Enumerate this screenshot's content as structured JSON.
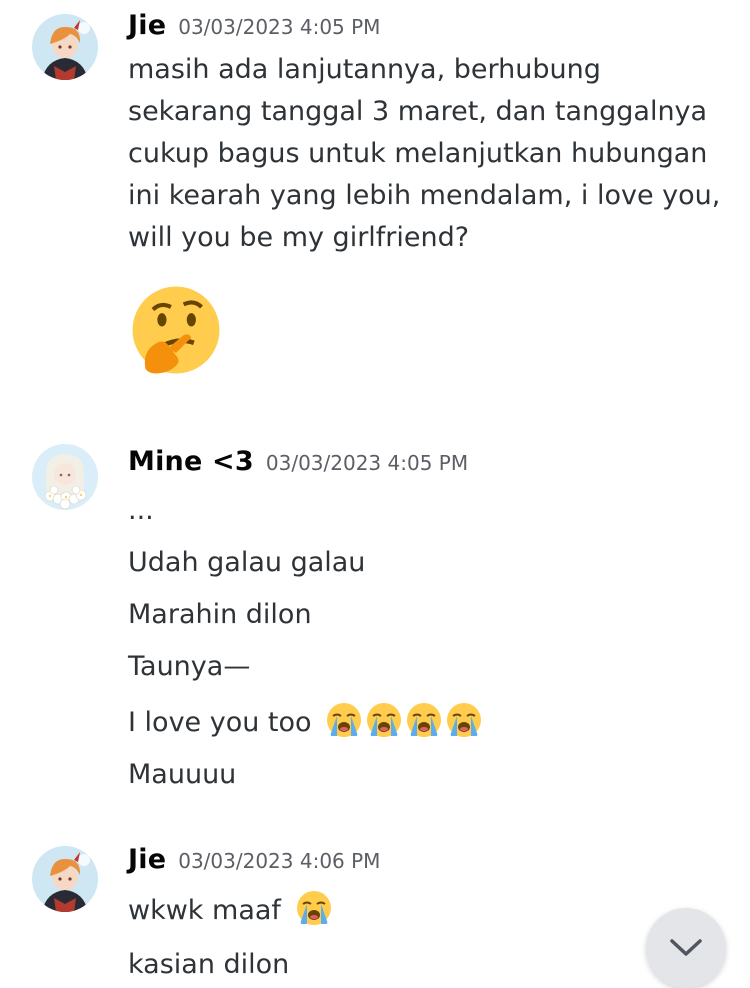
{
  "messages": [
    {
      "username": "Jie",
      "timestamp": "03/03/2023 4:05 PM",
      "avatar_icon": "anime-boy-avatar",
      "text": "masih ada lanjutannya, berhubung sekarang tanggal 3 maret, dan tanggalnya cukup bagus untuk melanjutkan hubungan ini kearah yang lebih mendalam, i love you, will you be my girlfriend?",
      "big_emoji": "thinking-face-emoji"
    },
    {
      "username": "Mine <3",
      "timestamp": "03/03/2023 4:05 PM",
      "avatar_icon": "anime-girl-flowers-avatar",
      "lines": [
        "...",
        "Udah galau galau",
        "Marahin dilon",
        "Taunya—",
        "I love you too",
        "Mauuuu"
      ],
      "love_line_emoji": "loudly-crying-face-emoji",
      "love_line_emoji_count": 4
    },
    {
      "username": "Jie",
      "timestamp": "03/03/2023 4:06 PM",
      "avatar_icon": "anime-boy-avatar",
      "lines": [
        "wkwk maaf",
        "kasian dilon"
      ],
      "first_line_emoji": "loudly-crying-face-emoji"
    }
  ],
  "scroll_button_icon": "chevron-down-icon"
}
